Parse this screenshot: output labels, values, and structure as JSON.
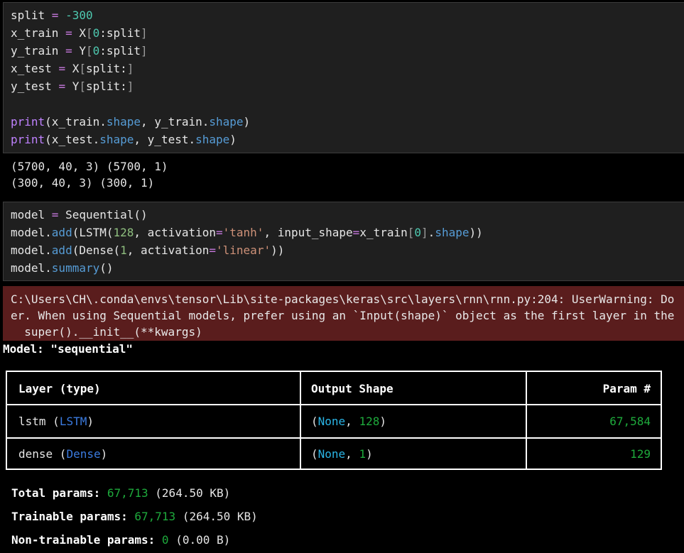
{
  "cell1": {
    "lines": [
      [
        {
          "t": "split ",
          "c": "var"
        },
        {
          "t": "=",
          "c": "op"
        },
        {
          "t": " ",
          "c": "var"
        },
        {
          "t": "-300",
          "c": "num"
        }
      ],
      [
        {
          "t": "x_train ",
          "c": "var"
        },
        {
          "t": "=",
          "c": "op"
        },
        {
          "t": " X",
          "c": "var"
        },
        {
          "t": "[",
          "c": "br"
        },
        {
          "t": "0",
          "c": "num"
        },
        {
          "t": ":split",
          "c": "var"
        },
        {
          "t": "]",
          "c": "br"
        }
      ],
      [
        {
          "t": "y_train ",
          "c": "var"
        },
        {
          "t": "=",
          "c": "op"
        },
        {
          "t": " Y",
          "c": "var"
        },
        {
          "t": "[",
          "c": "br"
        },
        {
          "t": "0",
          "c": "num"
        },
        {
          "t": ":split",
          "c": "var"
        },
        {
          "t": "]",
          "c": "br"
        }
      ],
      [
        {
          "t": "x_test ",
          "c": "var"
        },
        {
          "t": "=",
          "c": "op"
        },
        {
          "t": " X",
          "c": "var"
        },
        {
          "t": "[",
          "c": "br"
        },
        {
          "t": "split:",
          "c": "var"
        },
        {
          "t": "]",
          "c": "br"
        }
      ],
      [
        {
          "t": "y_test ",
          "c": "var"
        },
        {
          "t": "=",
          "c": "op"
        },
        {
          "t": " Y",
          "c": "var"
        },
        {
          "t": "[",
          "c": "br"
        },
        {
          "t": "split:",
          "c": "var"
        },
        {
          "t": "]",
          "c": "br"
        }
      ],
      [],
      [
        {
          "t": "print",
          "c": "fn"
        },
        {
          "t": "(x_train.",
          "c": "var"
        },
        {
          "t": "shape",
          "c": "attr"
        },
        {
          "t": ", y_train.",
          "c": "var"
        },
        {
          "t": "shape",
          "c": "attr"
        },
        {
          "t": ")",
          "c": "var"
        }
      ],
      [
        {
          "t": "print",
          "c": "fn"
        },
        {
          "t": "(x_test.",
          "c": "var"
        },
        {
          "t": "shape",
          "c": "attr"
        },
        {
          "t": ", y_test.",
          "c": "var"
        },
        {
          "t": "shape",
          "c": "attr"
        },
        {
          "t": ")",
          "c": "var"
        }
      ]
    ]
  },
  "output1": {
    "lines": [
      "(5700, 40, 3) (5700, 1)",
      "(300, 40, 3) (300, 1)"
    ]
  },
  "cell2": {
    "lines": [
      [
        {
          "t": "model ",
          "c": "var"
        },
        {
          "t": "=",
          "c": "op"
        },
        {
          "t": " Sequential()",
          "c": "var"
        }
      ],
      [
        {
          "t": "model.",
          "c": "var"
        },
        {
          "t": "add",
          "c": "attr"
        },
        {
          "t": "(LSTM(",
          "c": "var"
        },
        {
          "t": "128",
          "c": "num2"
        },
        {
          "t": ", activation",
          "c": "var"
        },
        {
          "t": "=",
          "c": "op"
        },
        {
          "t": "'tanh'",
          "c": "str"
        },
        {
          "t": ", input_shape",
          "c": "var"
        },
        {
          "t": "=",
          "c": "op"
        },
        {
          "t": "x_train",
          "c": "var"
        },
        {
          "t": "[",
          "c": "br"
        },
        {
          "t": "0",
          "c": "num"
        },
        {
          "t": "]",
          "c": "br"
        },
        {
          "t": ".",
          "c": "var"
        },
        {
          "t": "shape",
          "c": "attr"
        },
        {
          "t": "))",
          "c": "var"
        }
      ],
      [
        {
          "t": "model.",
          "c": "var"
        },
        {
          "t": "add",
          "c": "attr"
        },
        {
          "t": "(Dense(",
          "c": "var"
        },
        {
          "t": "1",
          "c": "num2"
        },
        {
          "t": ", activation",
          "c": "var"
        },
        {
          "t": "=",
          "c": "op"
        },
        {
          "t": "'linear'",
          "c": "str"
        },
        {
          "t": "))",
          "c": "var"
        }
      ],
      [
        {
          "t": "model.",
          "c": "var"
        },
        {
          "t": "summary",
          "c": "attr"
        },
        {
          "t": "()",
          "c": "var"
        }
      ]
    ]
  },
  "warning": {
    "lines": [
      "C:\\Users\\CH\\.conda\\envs\\tensor\\Lib\\site-packages\\keras\\src\\layers\\rnn\\rnn.py:204: UserWarning: Do",
      "er. When using Sequential models, prefer using an `Input(shape)` object as the first layer in the",
      "  super().__init__(**kwargs)"
    ]
  },
  "model": {
    "title": "Model: \"sequential\"",
    "headers": {
      "layer": "Layer (type)",
      "output": "Output Shape",
      "params": "Param #"
    },
    "rows": [
      {
        "name": "lstm ",
        "paren_open": "(",
        "type": "LSTM",
        "paren_close": ")",
        "out_open": "(",
        "none": "None",
        "sep": ", ",
        "dim": "128",
        "out_close": ")",
        "params": "67,584"
      },
      {
        "name": "dense ",
        "paren_open": "(",
        "type": "Dense",
        "paren_close": ")",
        "out_open": "(",
        "none": "None",
        "sep": ", ",
        "dim": "1",
        "out_close": ")",
        "params": "129"
      }
    ]
  },
  "summary": {
    "total_label": "Total params: ",
    "total_value": "67,713",
    "total_size": " (264.50 KB)",
    "trainable_label": "Trainable params: ",
    "trainable_value": "67,713",
    "trainable_size": " (264.50 KB)",
    "nontrainable_label": "Non-trainable params: ",
    "nontrainable_value": "0",
    "nontrainable_size": " (0.00 B)"
  }
}
